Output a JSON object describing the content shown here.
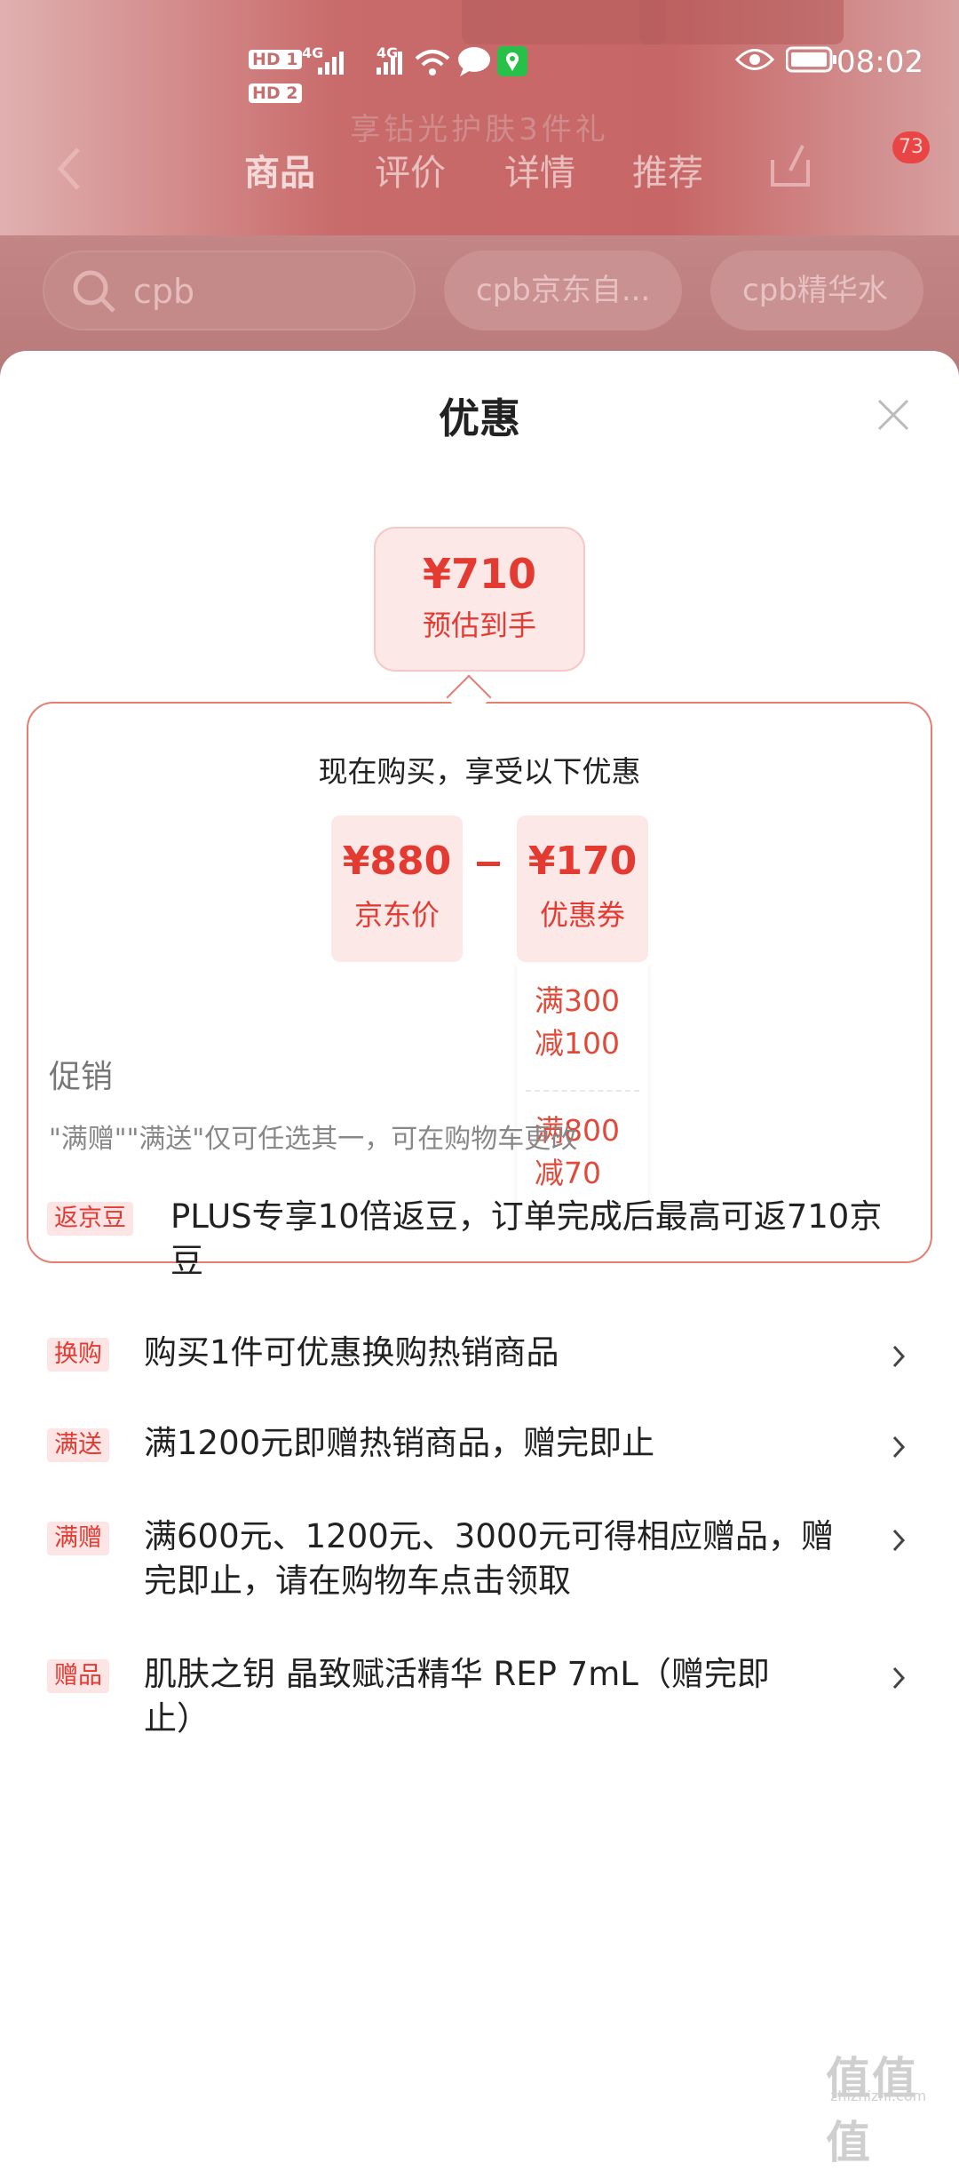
{
  "background": {
    "banner_text": "享钻光护肤3件礼",
    "status": {
      "hd1": "HD 1",
      "hd2": "HD 2",
      "net1": "4G",
      "net2": "4G",
      "time": "08:02"
    },
    "tabs": [
      "商品",
      "评价",
      "详情",
      "推荐"
    ],
    "cart_count": "73",
    "search": {
      "text": "cpb"
    },
    "chips": [
      "cpb京东自...",
      "cpb精华水"
    ]
  },
  "sheet": {
    "title": "优惠",
    "estimate": {
      "price": "¥710",
      "label": "预估到手"
    },
    "breakdown": {
      "title": "现在购买，享受以下优惠",
      "jd_price": {
        "value": "¥880",
        "label": "京东价"
      },
      "coupon": {
        "value": "¥170",
        "label": "优惠券"
      },
      "coupon_items": [
        {
          "line1": "满300",
          "line2": "减100"
        },
        {
          "line1": "满800",
          "line2": "减70"
        }
      ]
    },
    "promotions": {
      "title": "促销",
      "note": "\"满赠\"\"满送\"仅可任选其一，可在购物车更改",
      "items": [
        {
          "tag": "返京豆",
          "line1": "PLUS专享10倍返豆，订单完成后最高可返710京",
          "line2": "豆"
        },
        {
          "tag": "换购",
          "line1": "购买1件可优惠换购热销商品",
          "line2": ""
        },
        {
          "tag": "满送",
          "line1": "满1200元即赠热销商品，赠完即止",
          "line2": ""
        },
        {
          "tag": "满赠",
          "line1": "满600元、1200元、3000元可得相应赠品，赠",
          "line2": "完即止，请在购物车点击领取"
        },
        {
          "tag": "赠品",
          "line1": "肌肤之钥 晶致赋活精华 REP 7mL（赠完即",
          "line2": "止）"
        }
      ]
    }
  },
  "watermark": {
    "main": "值值值",
    "sub": "zhizhizhi.com"
  },
  "colors": {
    "accent": "#e33b32",
    "tag_bg": "#fde5e5",
    "border": "#e57d73"
  }
}
